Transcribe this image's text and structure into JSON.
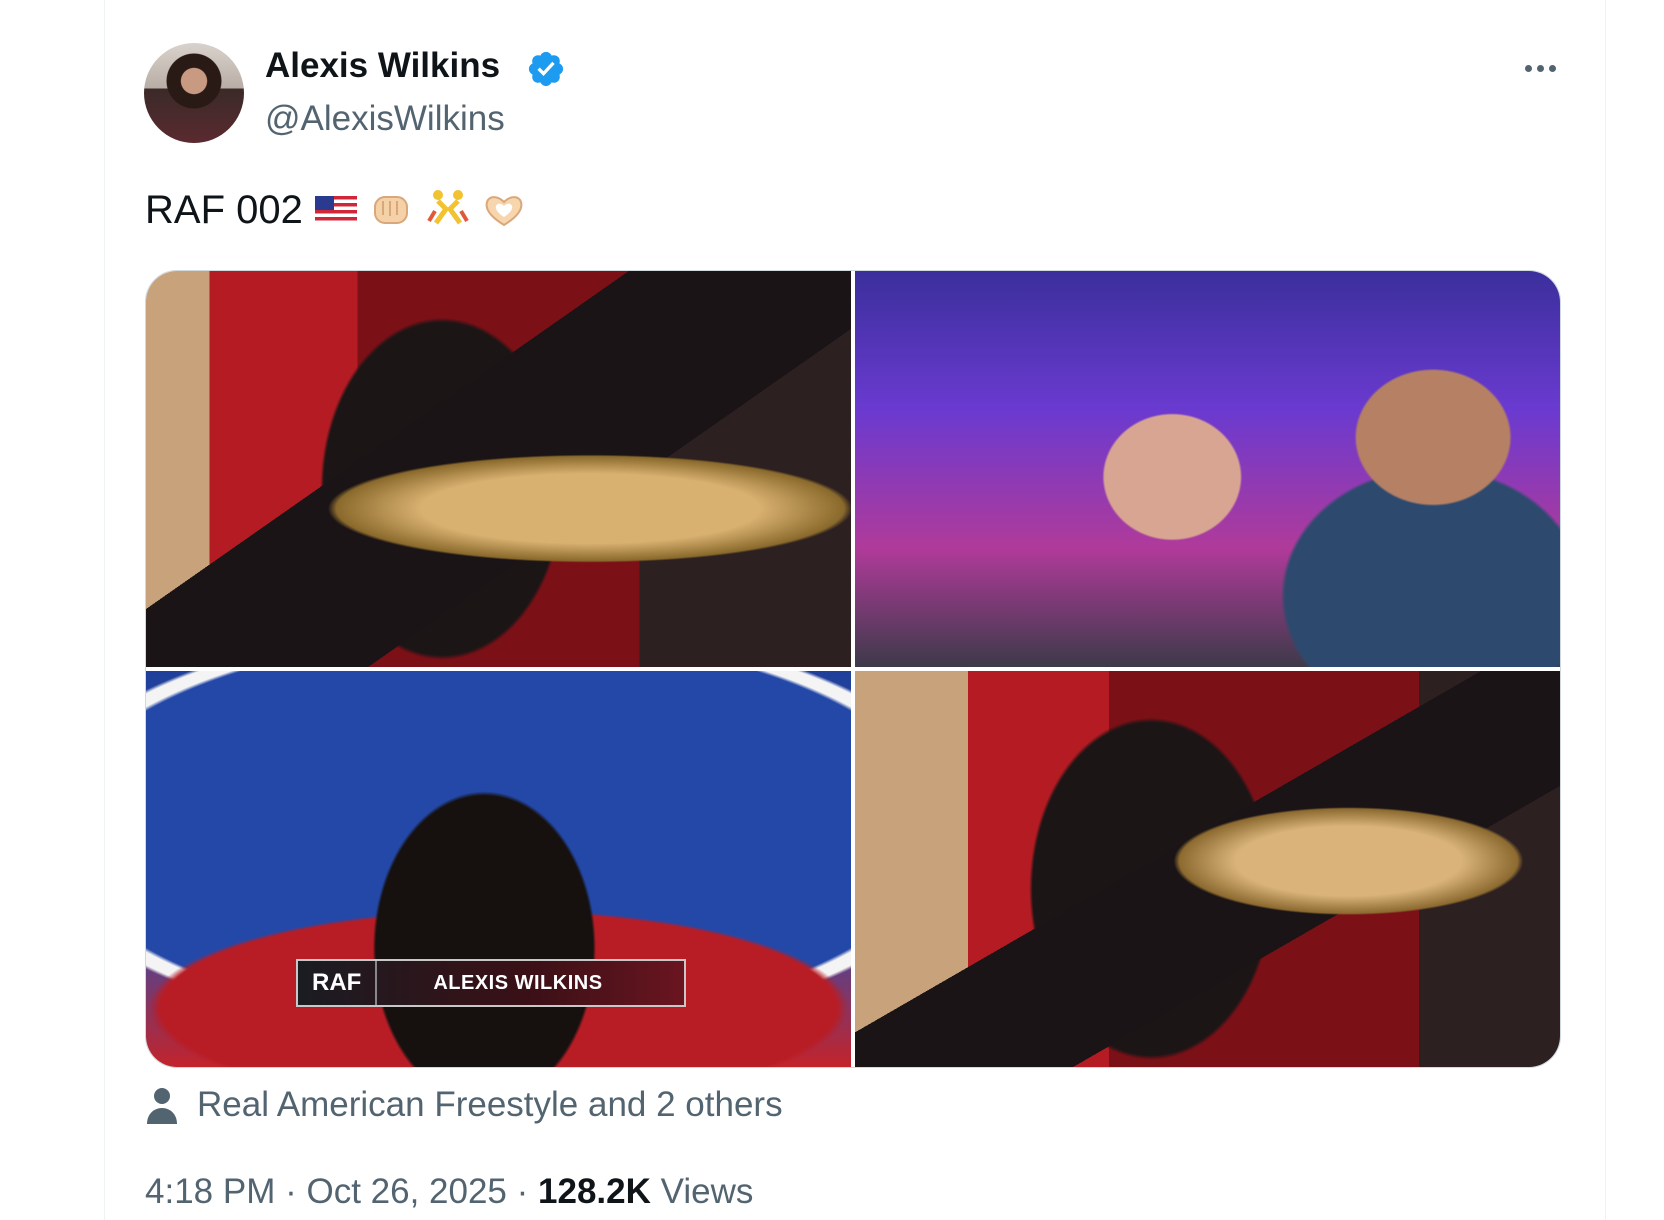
{
  "author": {
    "name": "Alexis Wilkins",
    "handle": "@AlexisWilkins",
    "verified": true
  },
  "tweet": {
    "text": "RAF 002",
    "emojis": [
      "us-flag-emoji",
      "fist-bump-emoji",
      "wrestlers-emoji",
      "heart-hands-emoji"
    ]
  },
  "media": {
    "photo_count": 4,
    "overlay": {
      "logo": "RAF",
      "name": "ALEXIS WILKINS"
    }
  },
  "tags": {
    "text": "Real American Freestyle and 2 others"
  },
  "meta": {
    "time": "4:18 PM",
    "date": "Oct 26, 2025",
    "views_count": "128.2K",
    "views_label": "Views"
  },
  "colors": {
    "verified": "#1d9bf0",
    "secondary_text": "#536471",
    "primary_text": "#0f1419"
  }
}
